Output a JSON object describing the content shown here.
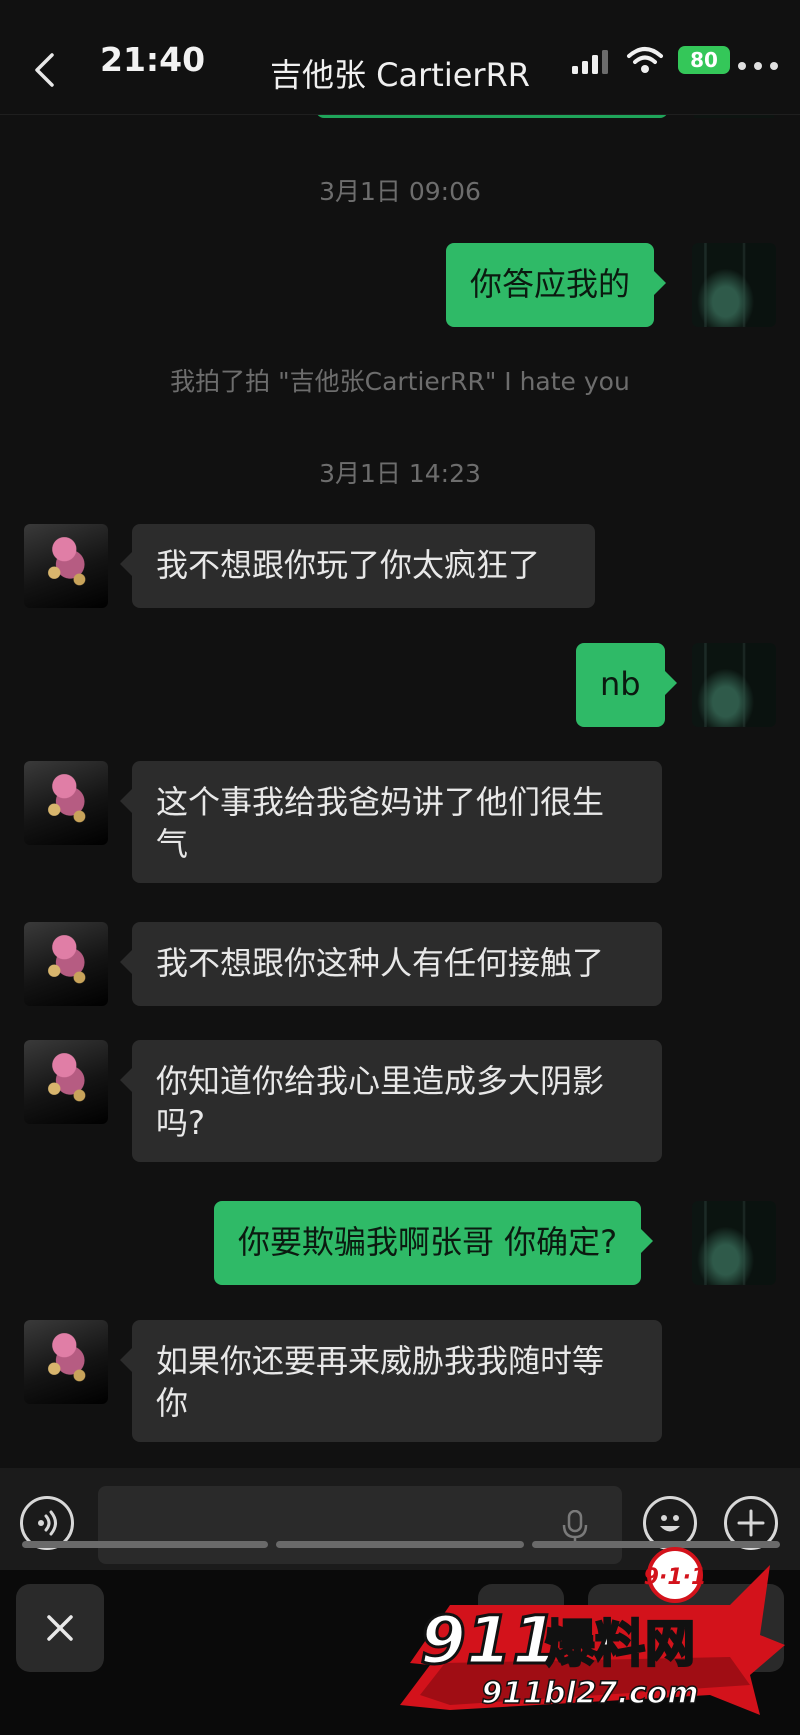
{
  "status_bar": {
    "time": "21:40",
    "battery": "80"
  },
  "header": {
    "title": "吉他张 CartierRR"
  },
  "messages": [
    {
      "type": "timestamp",
      "text": "3月1日 09:06"
    },
    {
      "type": "outgoing",
      "text": "你答应我的"
    },
    {
      "type": "system",
      "text": "我拍了拍 \"吉他张CartierRR\" I hate you"
    },
    {
      "type": "timestamp",
      "text": "3月1日 14:23"
    },
    {
      "type": "incoming",
      "text": "我不想跟你玩了你太疯狂了"
    },
    {
      "type": "outgoing",
      "text": "nb"
    },
    {
      "type": "incoming",
      "lines": [
        "这个事我给我爸妈讲了他们很生",
        "气"
      ]
    },
    {
      "type": "incoming",
      "text": "我不想跟你这种人有任何接触了"
    },
    {
      "type": "incoming",
      "lines": [
        "你知道你给我心里造成多大阴影",
        "吗?"
      ]
    },
    {
      "type": "outgoing",
      "text": "你要欺骗我啊张哥 你确定?"
    },
    {
      "type": "incoming",
      "lines": [
        "如果你还要再来威胁我我随时等",
        "你"
      ]
    }
  ],
  "watermark": {
    "badge": "9·1·1",
    "brand_number": "911",
    "brand_text": "爆料网",
    "url": "911bl27.com"
  },
  "colors": {
    "background": "#111111",
    "outgoing_bubble": "#2fba67",
    "incoming_bubble": "#2c2c2c",
    "battery": "#34c759",
    "watermark_red": "#d3121b"
  },
  "icons": {
    "back": "chevron-left-icon",
    "signal": "signal-icon",
    "wifi": "wifi-icon",
    "more": "more-icon",
    "voice": "voice-icon",
    "mic": "mic-icon",
    "emoji": "emoji-icon",
    "plus": "plus-icon",
    "close": "close-icon"
  }
}
